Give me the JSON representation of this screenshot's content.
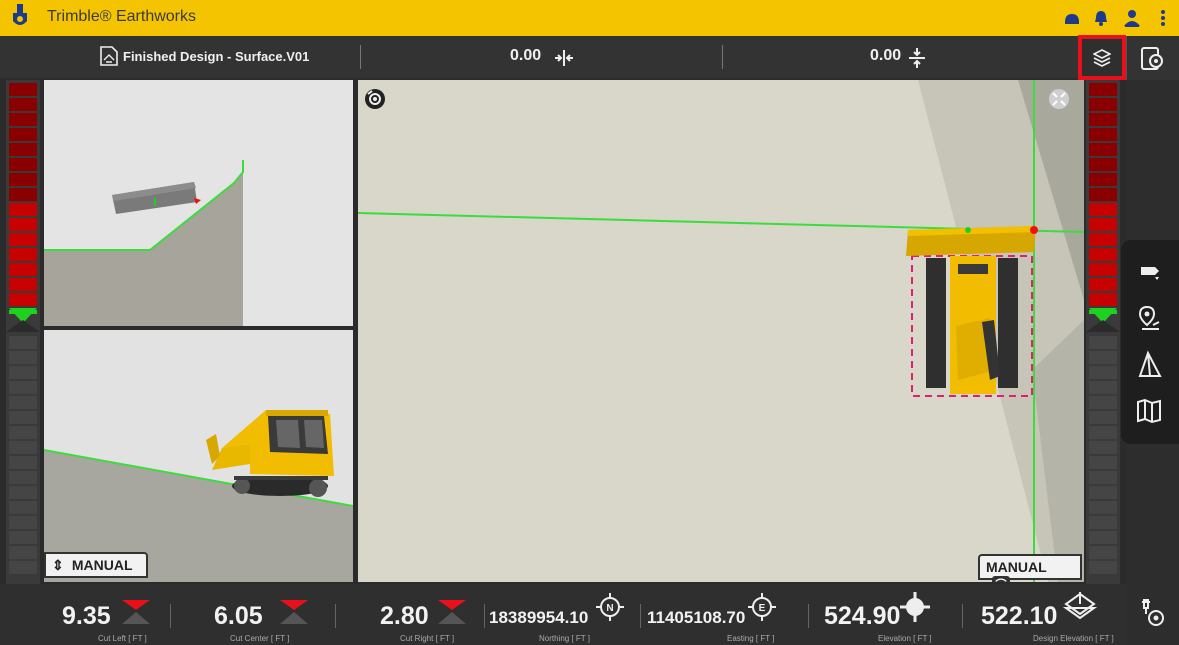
{
  "app": {
    "title": "Trimble® Earthworks"
  },
  "header": {
    "design_name": "Finished Design - Surface.V01",
    "cross_slope_value": "0.00",
    "mainfall_value": "0.00",
    "layers_icon": "layers-icon",
    "settings_icon": "device-settings-icon"
  },
  "views": {
    "main": {
      "mode_label": "MANUAL"
    },
    "profile": {
      "mode_label": "MANUAL"
    }
  },
  "status": {
    "items": [
      {
        "value": "9.35",
        "caption": "Cut Left  [ FT ]",
        "icon": "cut-down-arrow-icon"
      },
      {
        "value": "6.05",
        "caption": "Cut Center  [ FT ]",
        "icon": "cut-down-arrow-icon"
      },
      {
        "value": "2.80",
        "caption": "Cut Right  [ FT ]",
        "icon": "cut-down-arrow-icon"
      },
      {
        "value": "18389954.10",
        "caption": "Northing  [ FT ]",
        "icon": "north-compass-icon"
      },
      {
        "value": "11405108.70",
        "caption": "Easting  [ FT ]",
        "icon": "east-compass-icon"
      },
      {
        "value": "524.90",
        "caption": "Elevation  [ FT ]",
        "icon": "elevation-target-icon"
      },
      {
        "value": "522.10",
        "caption": "Design Elevation  [ FT ]",
        "icon": "design-elevation-icon"
      }
    ]
  },
  "colors": {
    "brand_yellow": "#f5c400",
    "highlight_red": "#e8101a",
    "gauge_red": "#c70000",
    "gauge_green": "#1fd11f",
    "design_line": "#3ddc3d"
  }
}
